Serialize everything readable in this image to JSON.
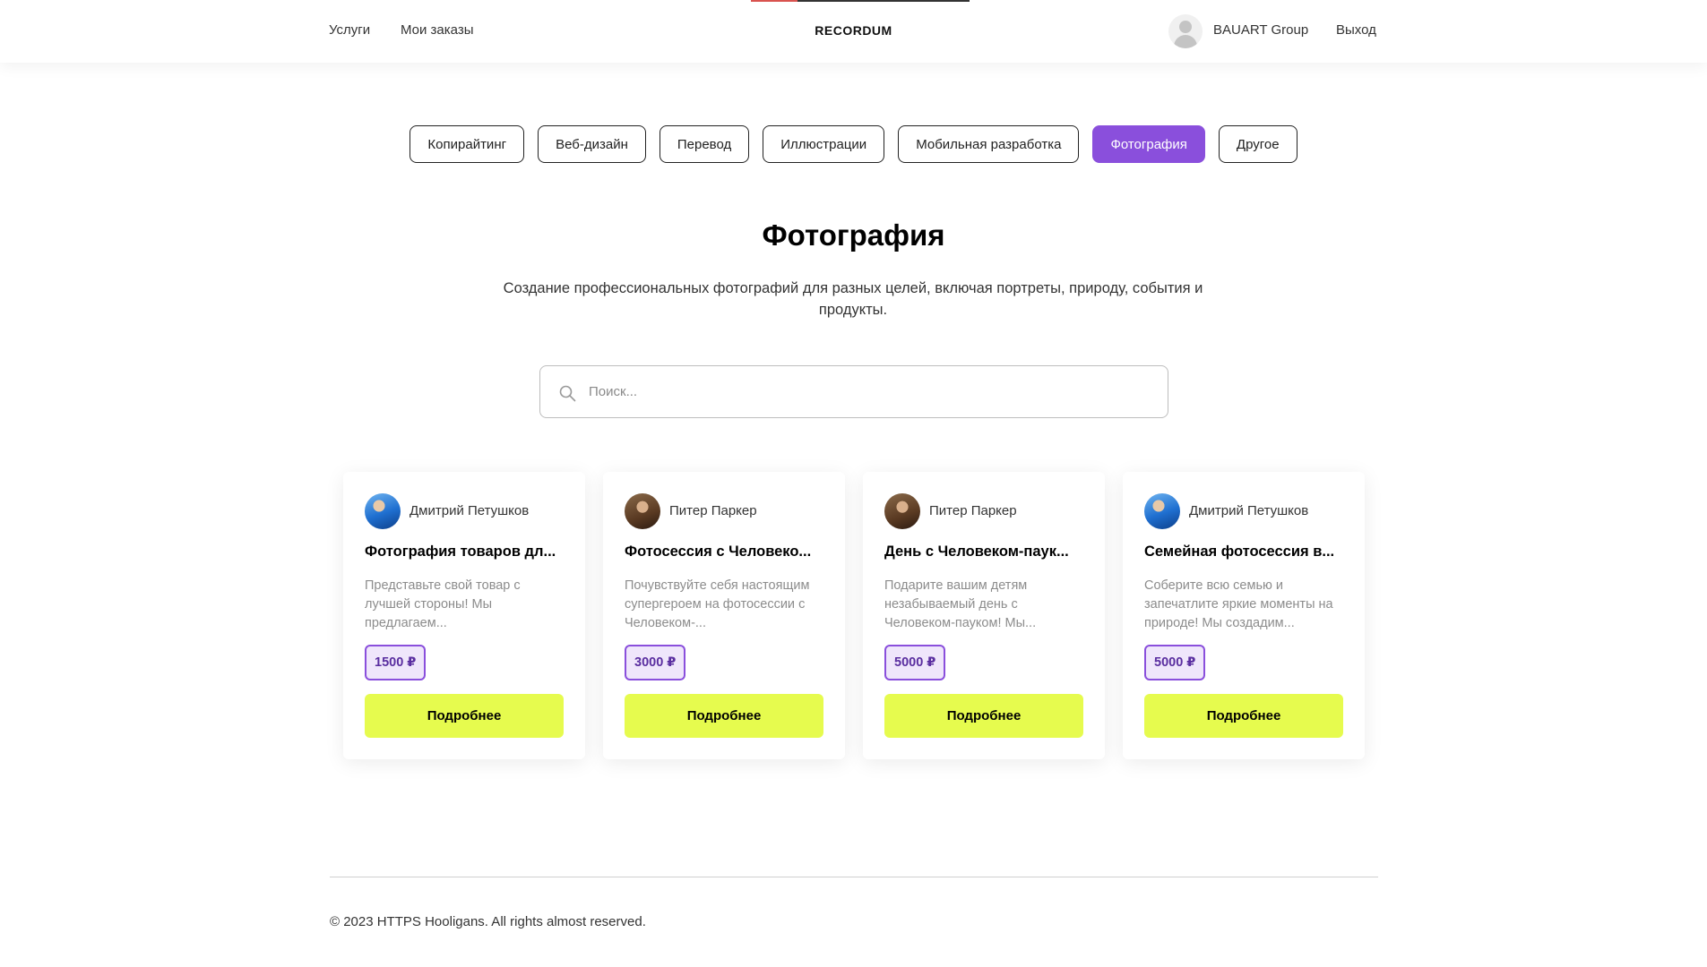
{
  "header": {
    "nav": [
      "Услуги",
      "Мои заказы"
    ],
    "logo": "RECORDUM",
    "user_name": "BAUART Group",
    "logout": "Выход"
  },
  "tabs": [
    {
      "label": "Копирайтинг",
      "active": false
    },
    {
      "label": "Веб-дизайн",
      "active": false
    },
    {
      "label": "Перевод",
      "active": false
    },
    {
      "label": "Иллюстрации",
      "active": false
    },
    {
      "label": "Мобильная разработка",
      "active": false
    },
    {
      "label": "Фотография",
      "active": true
    },
    {
      "label": "Другое",
      "active": false
    }
  ],
  "main": {
    "title": "Фотография",
    "description": "Создание профессиональных фотографий для разных целей, включая портреты, природу, события и продукты."
  },
  "search": {
    "placeholder": "Поиск...",
    "value": ""
  },
  "cards": [
    {
      "author": "Дмитрий Петушков",
      "title": "Фотография товаров дл...",
      "description": "Представьте свой товар с лучшей стороны! Мы предлагаем...",
      "price": "1500 ₽",
      "button": "Подробнее"
    },
    {
      "author": "Питер Паркер",
      "title": "Фотосессия с Человеко...",
      "description": "Почувствуйте себя настоящим супергероем на фотосессии с Человеком-...",
      "price": "3000 ₽",
      "button": "Подробнее"
    },
    {
      "author": "Питер Паркер",
      "title": "День с Человеком-паук...",
      "description": "Подарите вашим детям незабываемый день с Человеком-пауком! Мы...",
      "price": "5000 ₽",
      "button": "Подробнее"
    },
    {
      "author": "Дмитрий Петушков",
      "title": "Семейная фотосессия в...",
      "description": "Соберите всю семью и запечатлите яркие моменты на природе! Мы создадим...",
      "price": "5000 ₽",
      "button": "Подробнее"
    }
  ],
  "footer": {
    "text": "© 2023 HTTPS Hooligans. All rights almost reserved."
  },
  "colors": {
    "accent_purple": "#8a4fdc",
    "button_yellow": "#e6fb4e",
    "price_bg": "#efe6fb"
  }
}
